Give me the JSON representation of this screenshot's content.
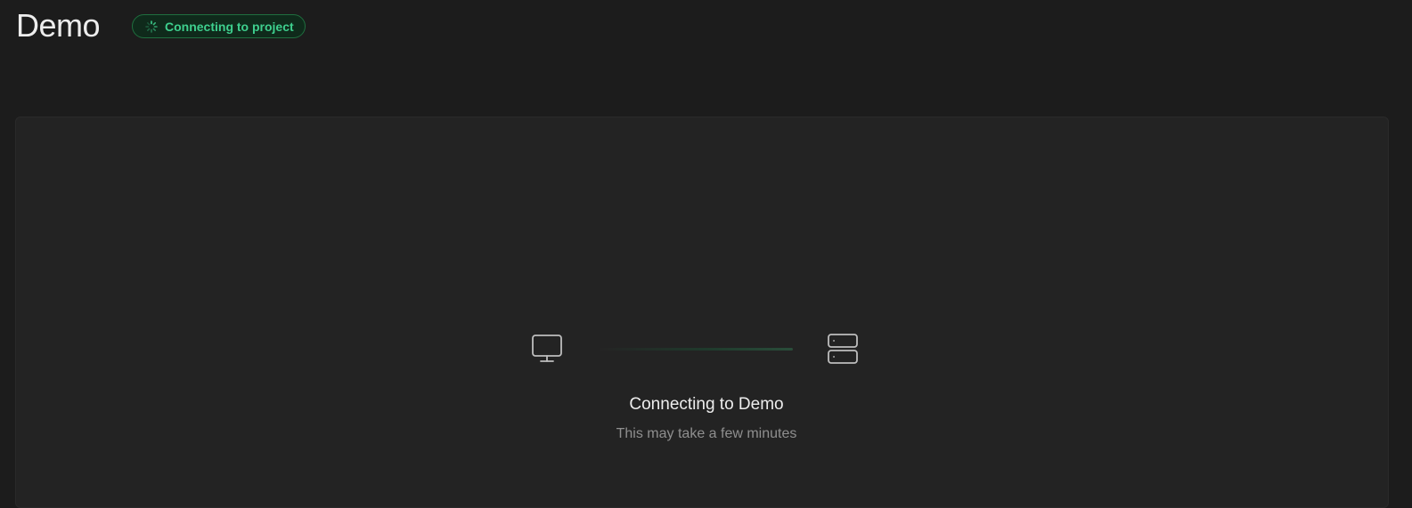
{
  "header": {
    "title": "Demo",
    "status": {
      "label": "Connecting to project",
      "icon": "spinner-icon",
      "color": "#3ecf8e"
    }
  },
  "main": {
    "icons": {
      "client": "monitor-icon",
      "server": "server-icon"
    },
    "title": "Connecting to Demo",
    "subtitle": "This may take a few minutes"
  },
  "colors": {
    "background": "#1c1c1c",
    "panel": "#232323",
    "accent": "#3ecf8e"
  }
}
